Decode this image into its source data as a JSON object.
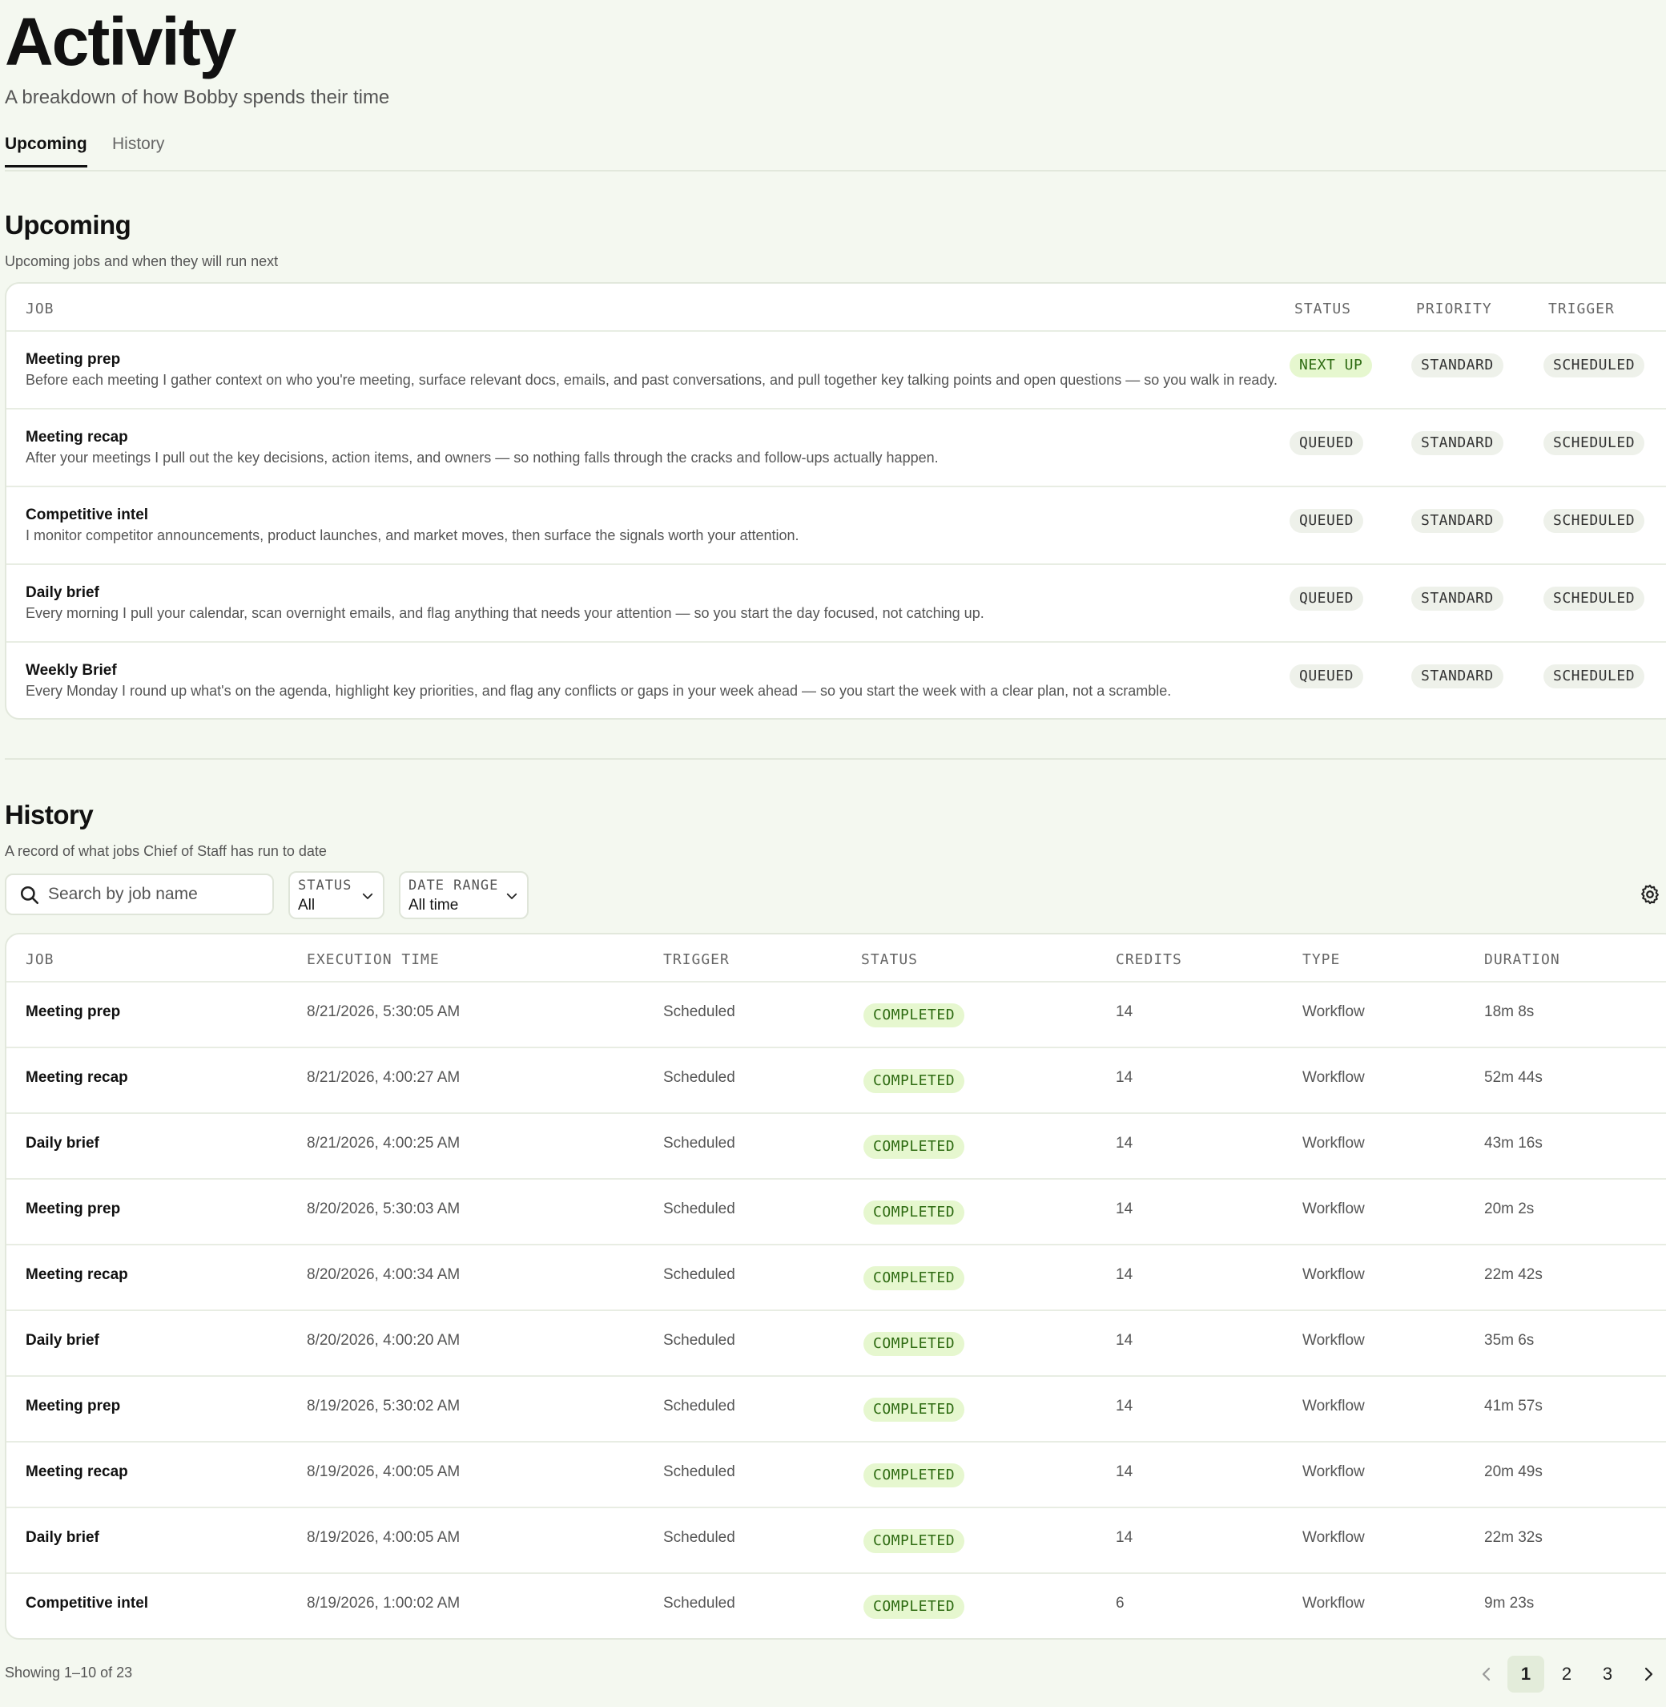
{
  "header": {
    "title": "Activity",
    "subtitle": "A breakdown of how Bobby spends their time"
  },
  "tabs": [
    {
      "label": "Upcoming",
      "active": true
    },
    {
      "label": "History",
      "active": false
    }
  ],
  "upcoming": {
    "title": "Upcoming",
    "subtitle": "Upcoming jobs and when they will run next",
    "columns": {
      "job": "JOB",
      "status": "STATUS",
      "priority": "PRIORITY",
      "trigger": "TRIGGER"
    },
    "rows": [
      {
        "name": "Meeting prep",
        "description": "Before each meeting I gather context on who you're meeting, surface relevant docs, emails, and past conversations, and pull together key talking points and open questions — so you walk in ready.",
        "status": "NEXT UP",
        "priority": "STANDARD",
        "trigger": "SCHEDULED"
      },
      {
        "name": "Meeting recap",
        "description": "After your meetings I pull out the key decisions, action items, and owners — so nothing falls through the cracks and follow-ups actually happen.",
        "status": "QUEUED",
        "priority": "STANDARD",
        "trigger": "SCHEDULED"
      },
      {
        "name": "Competitive intel",
        "description": "I monitor competitor announcements, product launches, and market moves, then surface the signals worth your attention.",
        "status": "QUEUED",
        "priority": "STANDARD",
        "trigger": "SCHEDULED"
      },
      {
        "name": "Daily brief",
        "description": "Every morning I pull your calendar, scan overnight emails, and flag anything that needs your attention — so you start the day focused, not catching up.",
        "status": "QUEUED",
        "priority": "STANDARD",
        "trigger": "SCHEDULED"
      },
      {
        "name": "Weekly Brief",
        "description": "Every Monday I round up what's on the agenda, highlight key priorities, and flag any conflicts or gaps in your week ahead — so you start the week with a clear plan, not a scramble.",
        "status": "QUEUED",
        "priority": "STANDARD",
        "trigger": "SCHEDULED"
      }
    ]
  },
  "history": {
    "title": "History",
    "subtitle": "A record of what jobs Chief of Staff has run to date",
    "search_placeholder": "Search by job name",
    "status_filter": {
      "label": "STATUS",
      "value": "All"
    },
    "date_filter": {
      "label": "DATE RANGE",
      "value": "All time"
    },
    "columns": {
      "job": "JOB",
      "execution_time": "EXECUTION TIME",
      "trigger": "TRIGGER",
      "status": "STATUS",
      "credits": "CREDITS",
      "type": "TYPE",
      "duration": "DURATION"
    },
    "rows": [
      {
        "job": "Meeting prep",
        "time": "8/21/2026, 5:30:05 AM",
        "trigger": "Scheduled",
        "status": "COMPLETED",
        "credits": "14",
        "type": "Workflow",
        "duration": "18m 8s"
      },
      {
        "job": "Meeting recap",
        "time": "8/21/2026, 4:00:27 AM",
        "trigger": "Scheduled",
        "status": "COMPLETED",
        "credits": "14",
        "type": "Workflow",
        "duration": "52m 44s"
      },
      {
        "job": "Daily brief",
        "time": "8/21/2026, 4:00:25 AM",
        "trigger": "Scheduled",
        "status": "COMPLETED",
        "credits": "14",
        "type": "Workflow",
        "duration": "43m 16s"
      },
      {
        "job": "Meeting prep",
        "time": "8/20/2026, 5:30:03 AM",
        "trigger": "Scheduled",
        "status": "COMPLETED",
        "credits": "14",
        "type": "Workflow",
        "duration": "20m 2s"
      },
      {
        "job": "Meeting recap",
        "time": "8/20/2026, 4:00:34 AM",
        "trigger": "Scheduled",
        "status": "COMPLETED",
        "credits": "14",
        "type": "Workflow",
        "duration": "22m 42s"
      },
      {
        "job": "Daily brief",
        "time": "8/20/2026, 4:00:20 AM",
        "trigger": "Scheduled",
        "status": "COMPLETED",
        "credits": "14",
        "type": "Workflow",
        "duration": "35m 6s"
      },
      {
        "job": "Meeting prep",
        "time": "8/19/2026, 5:30:02 AM",
        "trigger": "Scheduled",
        "status": "COMPLETED",
        "credits": "14",
        "type": "Workflow",
        "duration": "41m 57s"
      },
      {
        "job": "Meeting recap",
        "time": "8/19/2026, 4:00:05 AM",
        "trigger": "Scheduled",
        "status": "COMPLETED",
        "credits": "14",
        "type": "Workflow",
        "duration": "20m 49s"
      },
      {
        "job": "Daily brief",
        "time": "8/19/2026, 4:00:05 AM",
        "trigger": "Scheduled",
        "status": "COMPLETED",
        "credits": "14",
        "type": "Workflow",
        "duration": "22m 32s"
      },
      {
        "job": "Competitive intel",
        "time": "8/19/2026, 1:00:02 AM",
        "trigger": "Scheduled",
        "status": "COMPLETED",
        "credits": "6",
        "type": "Workflow",
        "duration": "9m 23s"
      }
    ],
    "showing": "Showing 1–10 of 23",
    "pages": [
      "1",
      "2",
      "3"
    ],
    "current_page": "1"
  },
  "icons": {
    "search": "search-icon",
    "settings": "gear-icon",
    "dropdown": "chevron-down-icon",
    "prev": "chevron-left-icon",
    "next": "chevron-right-icon"
  },
  "colors": {
    "background": "#f4f8f0",
    "accent_pill": "#e6f7cf",
    "accent_text": "#2e6b12",
    "neutral_pill": "#eef1ea"
  }
}
